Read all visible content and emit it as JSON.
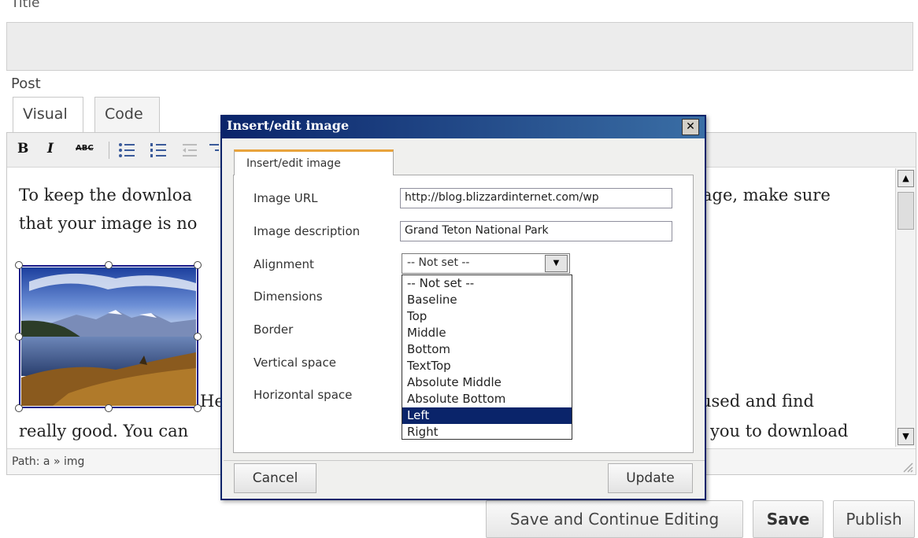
{
  "page": {
    "title_label": "Title",
    "post_label": "Post",
    "tabs": {
      "visual": "Visual",
      "code": "Code"
    },
    "toolbar": {
      "bold": "B",
      "italic": "I",
      "strike": "ABC"
    },
    "content_lines": [
      "To keep the downloa",
      "age, make sure",
      "that your image is no",
      "He",
      "used and find",
      "really good.  You can",
      "you to download"
    ],
    "path_text": "Path: a » img",
    "buttons": {
      "save_continue": "Save and Continue Editing",
      "save": "Save",
      "publish": "Publish"
    }
  },
  "dialog": {
    "title": "Insert/edit image",
    "tab": "Insert/edit image",
    "fields": {
      "image_url_label": "Image URL",
      "image_url_value": "http://blog.blizzardinternet.com/wp",
      "image_description_label": "Image description",
      "image_description_value": "Grand Teton National Park",
      "alignment_label": "Alignment",
      "alignment_value": "-- Not set --",
      "dimensions_label": "Dimensions",
      "border_label": "Border",
      "vertical_space_label": "Vertical space",
      "horizontal_space_label": "Horizontal space"
    },
    "alignment_options": [
      "-- Not set --",
      "Baseline",
      "Top",
      "Middle",
      "Bottom",
      "TextTop",
      "Absolute Middle",
      "Absolute Bottom",
      "Left",
      "Right"
    ],
    "selected_alignment": "Left",
    "cancel_label": "Cancel",
    "update_label": "Update"
  },
  "icons": {
    "close": "close-icon",
    "dropdown": "chevron-down-icon",
    "scroll_up": "arrow-up-icon",
    "scroll_down": "arrow-down-icon"
  }
}
